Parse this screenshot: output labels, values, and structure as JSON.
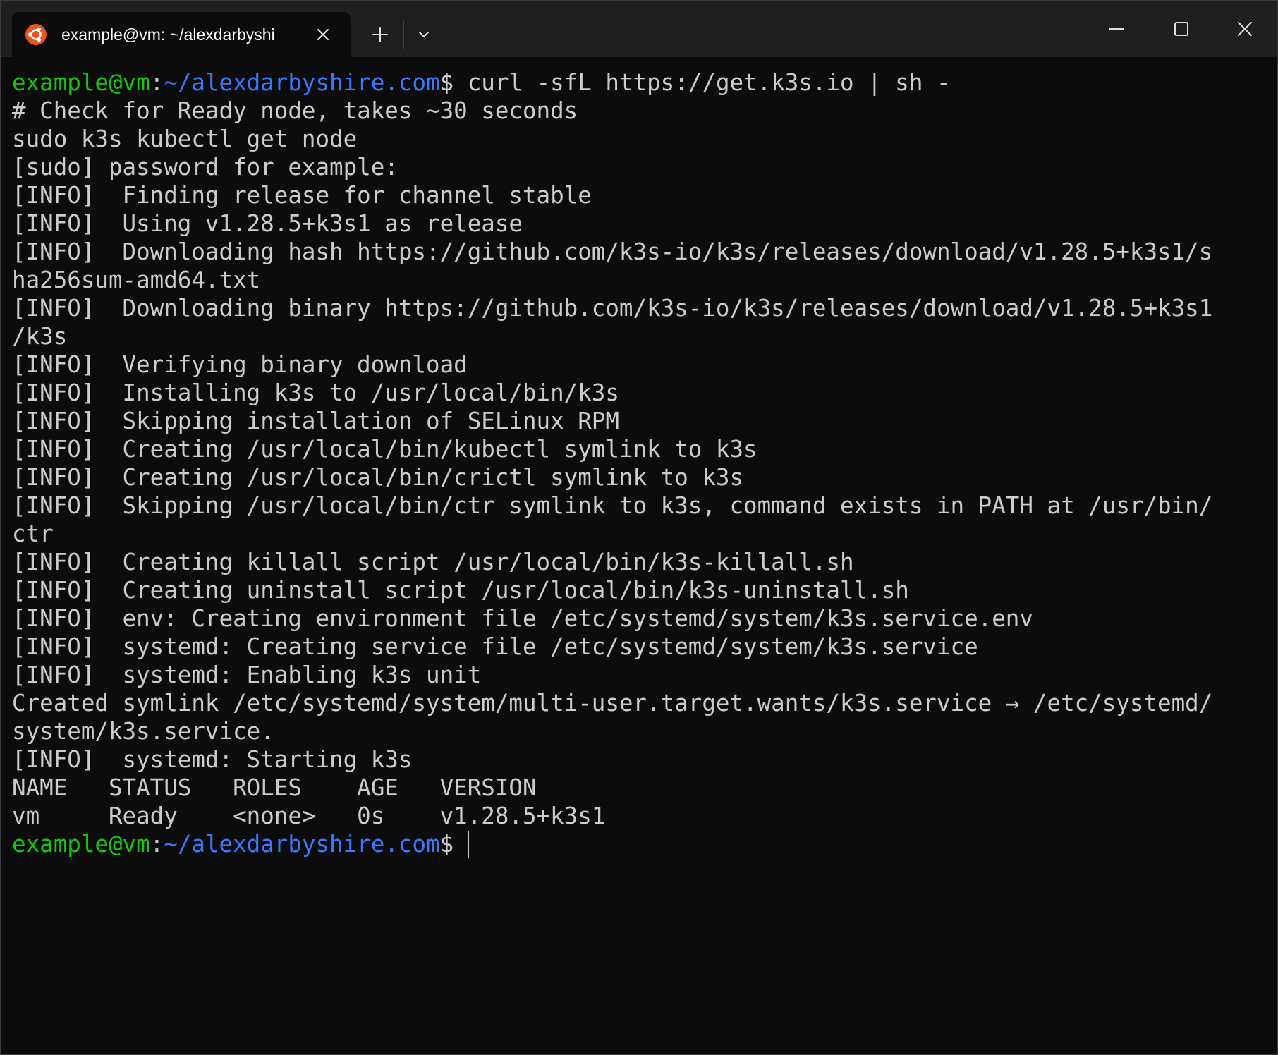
{
  "window": {
    "tab": {
      "icon": "ubuntu-icon",
      "title": "example@vm: ~/alexdarbyshi",
      "close_icon": "close-icon"
    },
    "new_tab_icon": "plus-icon",
    "dropdown_icon": "chevron-down-icon",
    "controls": [
      "minimize-icon",
      "maximize-icon",
      "close-icon"
    ]
  },
  "colors": {
    "background": "#0c0c0c",
    "text": "#cccccc",
    "prompt_user": "#16c60c",
    "prompt_path": "#3b78ff",
    "ubuntu_orange": "#e95420"
  },
  "prompt": {
    "user": "example@vm",
    "sep": ":",
    "path": "~/alexdarbyshire.com",
    "symbol": "$"
  },
  "command": " curl -sfL https://get.k3s.io | sh -",
  "output": [
    "# Check for Ready node, takes ~30 seconds",
    "sudo k3s kubectl get node",
    "[sudo] password for example:",
    "[INFO]  Finding release for channel stable",
    "[INFO]  Using v1.28.5+k3s1 as release",
    "[INFO]  Downloading hash https://github.com/k3s-io/k3s/releases/download/v1.28.5+k3s1/s",
    "ha256sum-amd64.txt",
    "[INFO]  Downloading binary https://github.com/k3s-io/k3s/releases/download/v1.28.5+k3s1",
    "/k3s",
    "[INFO]  Verifying binary download",
    "[INFO]  Installing k3s to /usr/local/bin/k3s",
    "[INFO]  Skipping installation of SELinux RPM",
    "[INFO]  Creating /usr/local/bin/kubectl symlink to k3s",
    "[INFO]  Creating /usr/local/bin/crictl symlink to k3s",
    "[INFO]  Skipping /usr/local/bin/ctr symlink to k3s, command exists in PATH at /usr/bin/",
    "ctr",
    "[INFO]  Creating killall script /usr/local/bin/k3s-killall.sh",
    "[INFO]  Creating uninstall script /usr/local/bin/k3s-uninstall.sh",
    "[INFO]  env: Creating environment file /etc/systemd/system/k3s.service.env",
    "[INFO]  systemd: Creating service file /etc/systemd/system/k3s.service",
    "[INFO]  systemd: Enabling k3s unit",
    "Created symlink /etc/systemd/system/multi-user.target.wants/k3s.service → /etc/systemd/",
    "system/k3s.service.",
    "[INFO]  systemd: Starting k3s",
    "NAME   STATUS   ROLES    AGE   VERSION",
    "vm     Ready    <none>   0s    v1.28.5+k3s1"
  ]
}
